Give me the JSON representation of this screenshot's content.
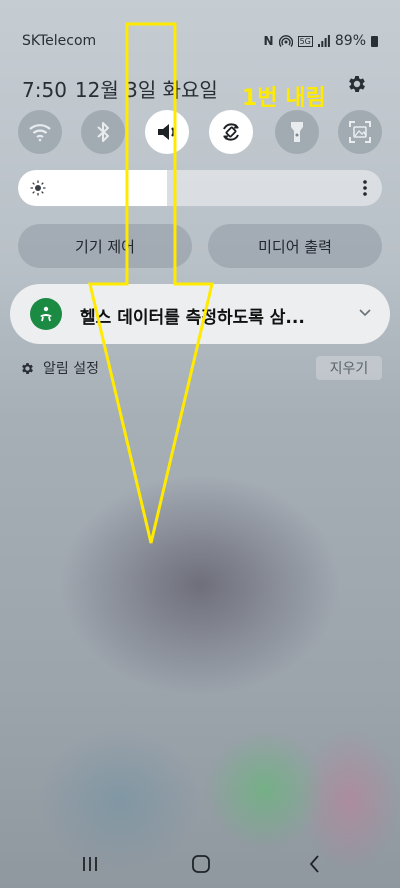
{
  "status_bar": {
    "carrier": "SKTelecom",
    "nfc_label": "N",
    "network_badge": "5G",
    "battery": "89%"
  },
  "header": {
    "time": "7:50",
    "date": "12월 3일 화요일"
  },
  "annotation": {
    "label": "1번 내림",
    "color": "#ffea00"
  },
  "quick_settings": [
    {
      "icon": "wifi-icon",
      "active": false
    },
    {
      "icon": "bluetooth-icon",
      "active": false
    },
    {
      "icon": "sound-icon",
      "active": true
    },
    {
      "icon": "auto-rotate-icon",
      "active": true
    },
    {
      "icon": "flashlight-icon",
      "active": false
    },
    {
      "icon": "screen-capture-icon",
      "active": false
    }
  ],
  "brightness": {
    "level": 0.41
  },
  "buttons": {
    "device_control": "기기 제어",
    "media_output": "미디어 출력"
  },
  "notification": {
    "text": "헬스 데이터를 측정하도록 삼...",
    "app_color": "#1b8a43"
  },
  "notification_settings": {
    "label": "알림 설정",
    "clear": "지우기"
  }
}
